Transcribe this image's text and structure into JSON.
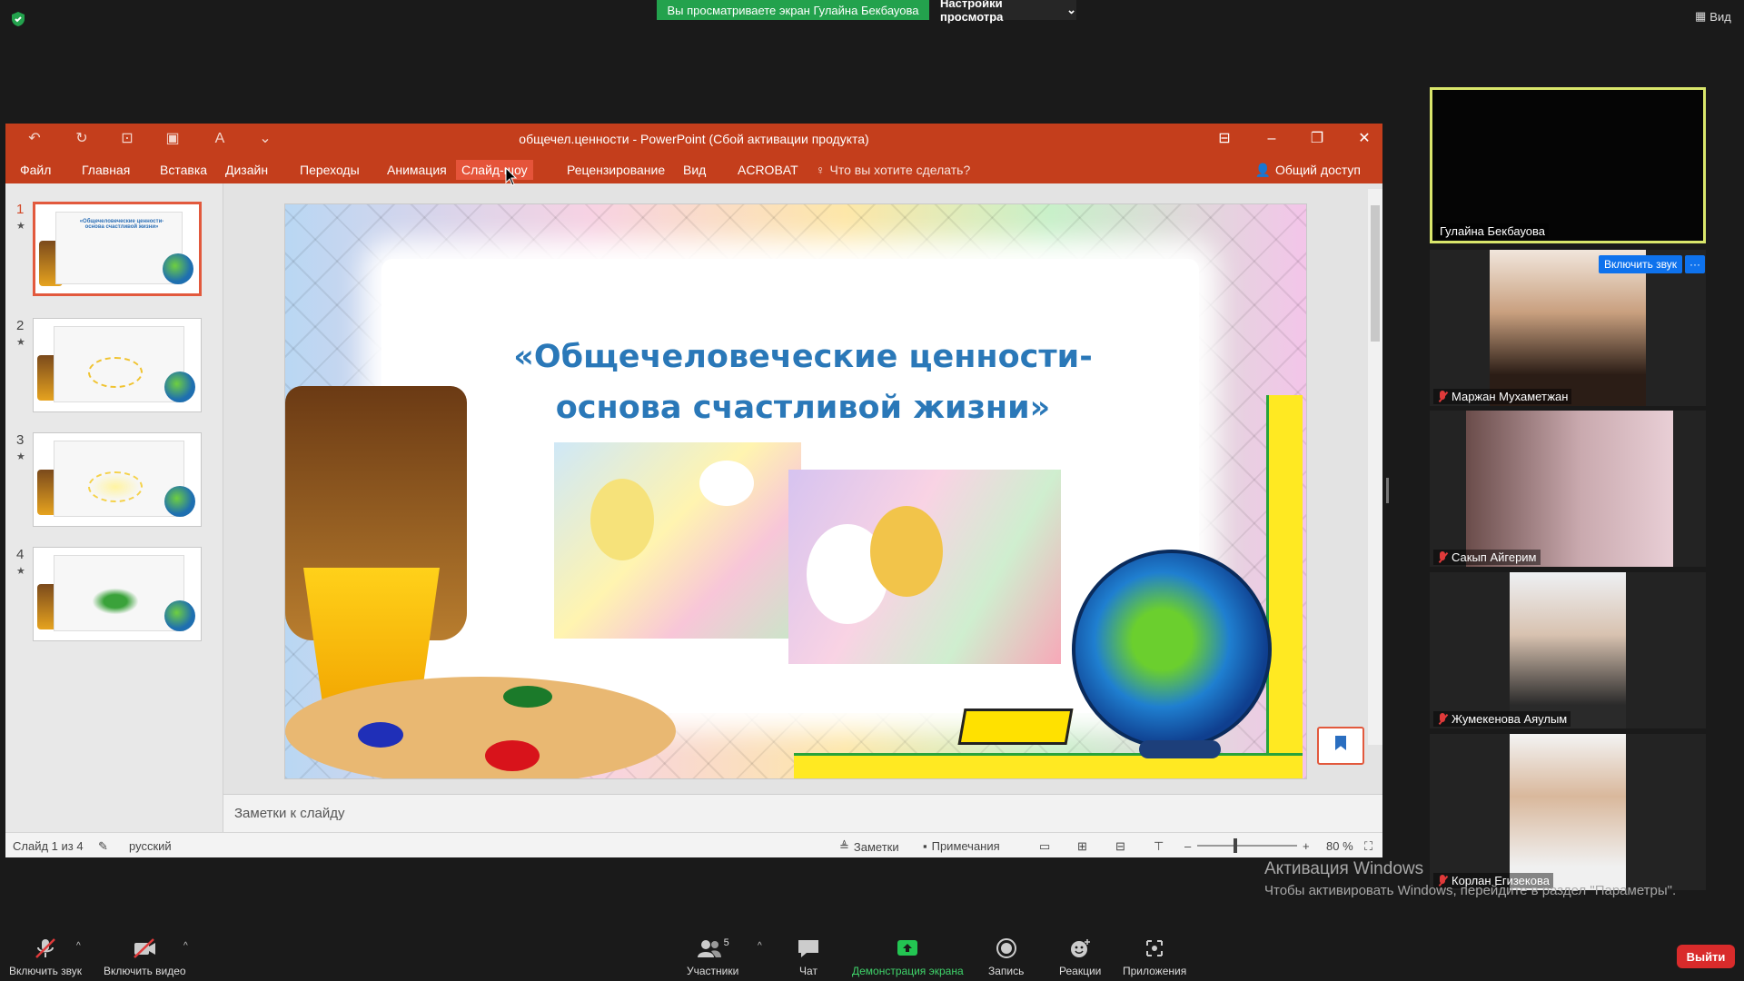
{
  "zoom_top": {
    "share_banner": "Вы просматриваете экран Гулайна Бекбауова",
    "view_settings": "Настройки просмотра",
    "view_button": "Вид"
  },
  "ppt": {
    "window_title": "общечел.ценности - PowerPoint (Сбой активации продукта)",
    "tabs": [
      "Файл",
      "Главная",
      "Вставка",
      "Дизайн",
      "Переходы",
      "Анимация",
      "Слайд-шоу",
      "Рецензирование",
      "Вид",
      "ACROBAT"
    ],
    "active_tab": "Слайд-шоу",
    "tell_me": "Что вы хотите сделать?",
    "share": "Общий доступ",
    "thumbnails": [
      {
        "num": "1",
        "title": "«Общечеловеческие ценности-основа счастливой жизни»"
      },
      {
        "num": "2"
      },
      {
        "num": "3"
      },
      {
        "num": "4"
      }
    ],
    "slide": {
      "title_line1": "«Общечеловеческие ценности-",
      "title_line2": "основа счастливой жизни»"
    },
    "notes_placeholder": "Заметки к слайду",
    "status": {
      "slide_counter": "Слайд 1 из 4",
      "language": "русский",
      "notes": "Заметки",
      "comments": "Примечания",
      "zoom": "80 %"
    }
  },
  "participants": [
    {
      "name": "Гулайна Бекбауова",
      "active_speaker": true,
      "muted": false
    },
    {
      "name": "Маржан Мухаметжан",
      "muted": true
    },
    {
      "name": "Сакып Айгерим",
      "muted": true
    },
    {
      "name": "Жумекенова Аяулым",
      "muted": true
    },
    {
      "name": "Корлан Егизекова",
      "muted": true
    }
  ],
  "participant_actions": {
    "unmute": "Включить звук",
    "more": "···"
  },
  "windows_activation": {
    "title": "Активация Windows",
    "subtitle": "Чтобы активировать Windows, перейдите в раздел \"Параметры\"."
  },
  "toolbar": {
    "audio": "Включить звук",
    "video": "Включить видео",
    "participants": "Участники",
    "participants_count": "5",
    "chat": "Чат",
    "share_screen": "Демонстрация экрана",
    "record": "Запись",
    "reactions": "Реакции",
    "apps": "Приложения",
    "leave": "Выйти"
  },
  "colors": {
    "ppt_accent": "#c43e1c",
    "share_green": "#23a24d",
    "zoom_blue": "#0e72ed",
    "leave_red": "#d92b2b",
    "active_speaker_border": "#d9e66b"
  }
}
